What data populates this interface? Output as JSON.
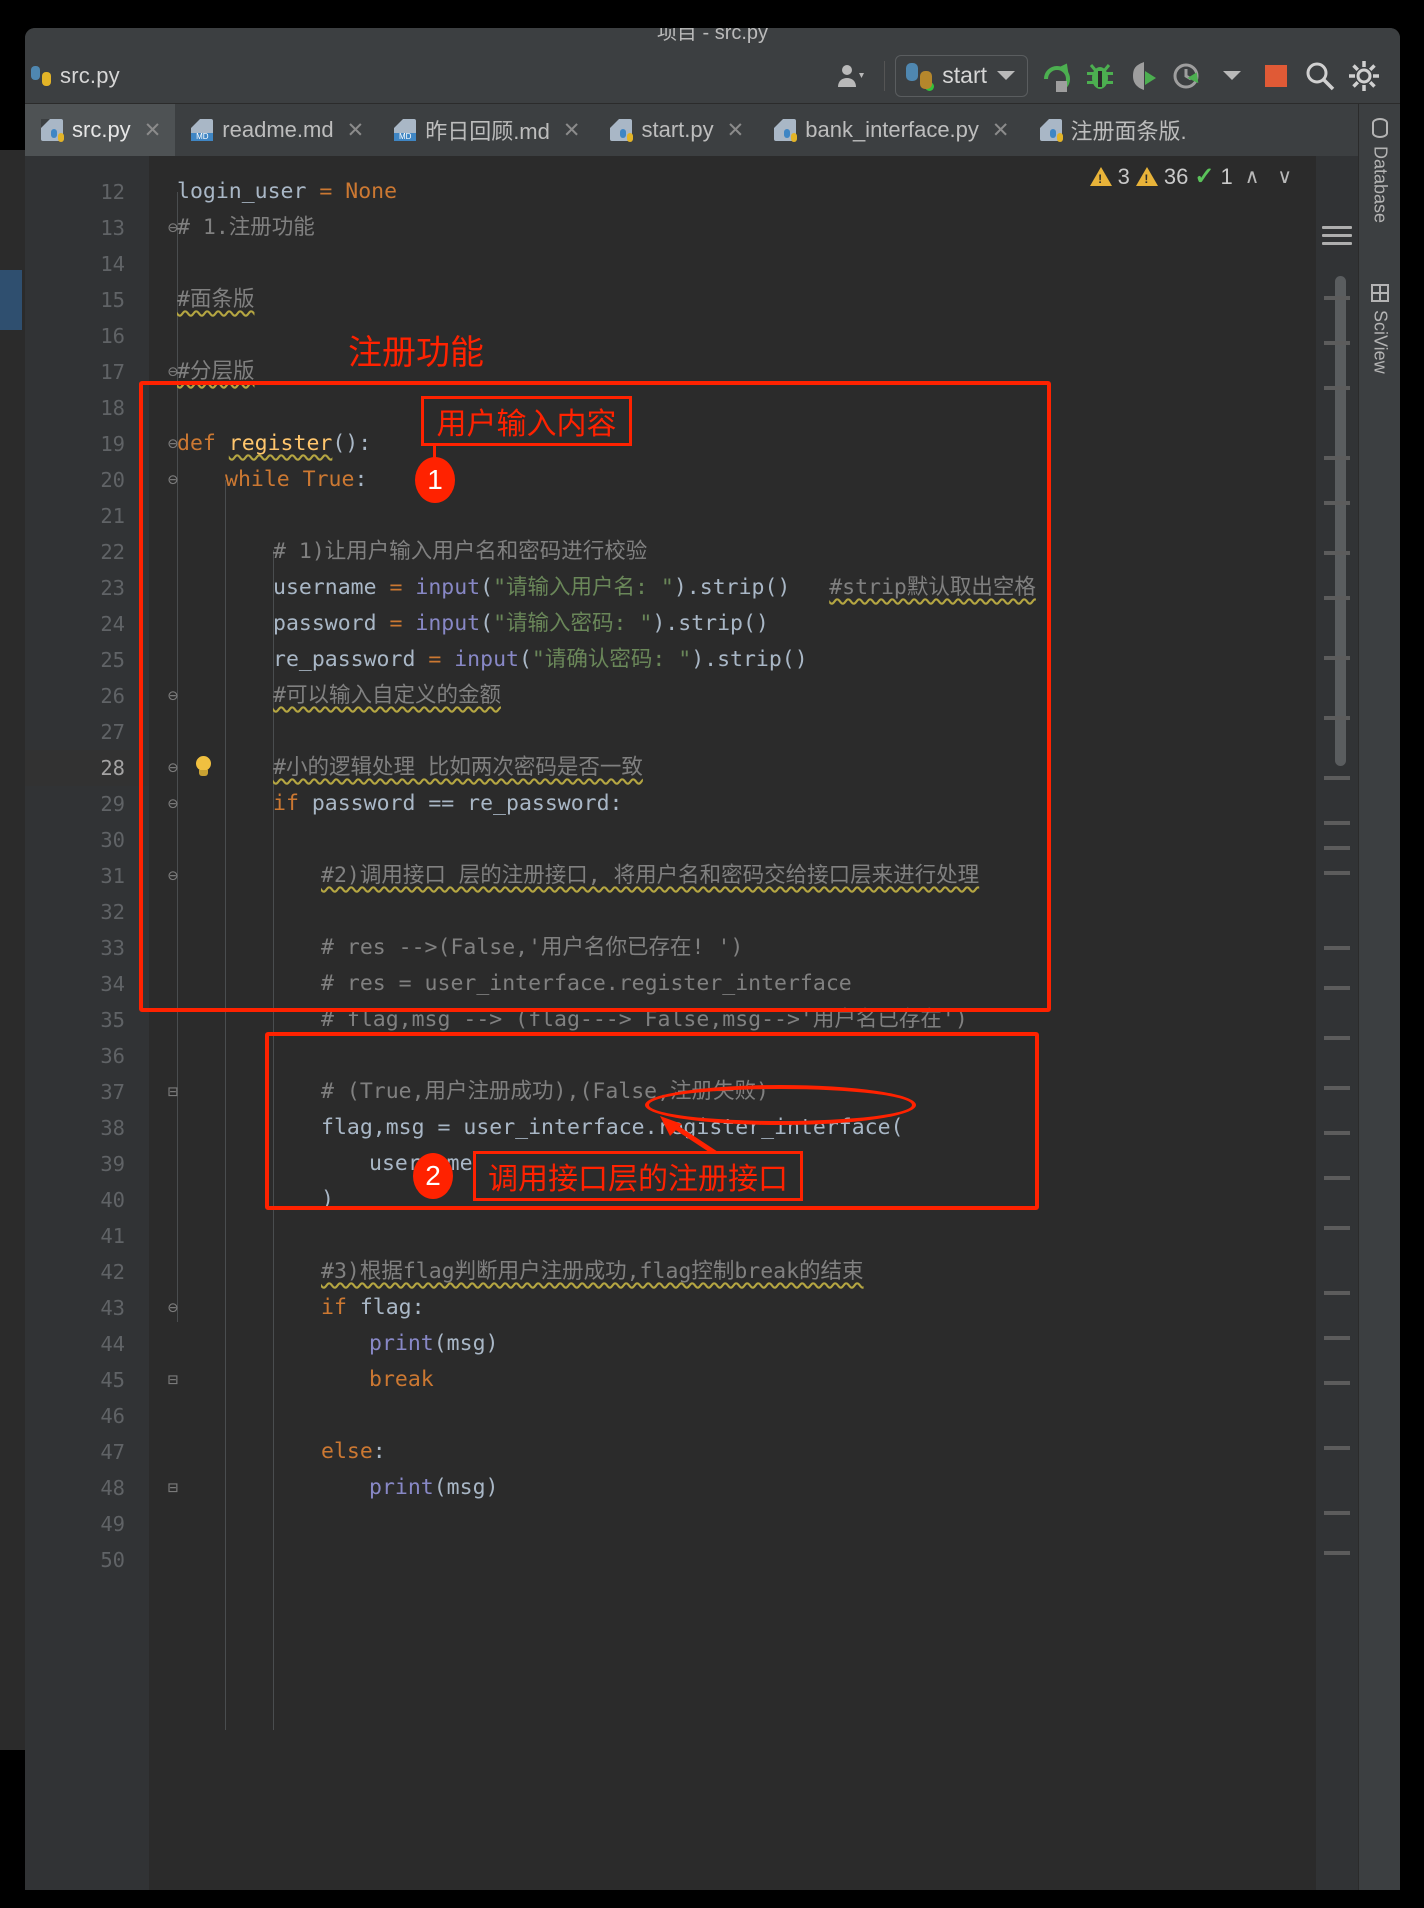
{
  "window": {
    "title_partial": "项目 - src.py",
    "breadcrumb": "src.py"
  },
  "toolbar": {
    "run_config_name": "start",
    "icons": [
      {
        "name": "user-avatar-icon",
        "glyph": "A"
      },
      {
        "name": "rerun-icon"
      },
      {
        "name": "debug-icon"
      },
      {
        "name": "coverage-icon"
      },
      {
        "name": "profile-icon"
      },
      {
        "name": "stop-icon"
      },
      {
        "name": "search-icon"
      },
      {
        "name": "settings-gear-icon"
      }
    ]
  },
  "tabs": [
    {
      "label": "src.py",
      "icon": "python-file-icon",
      "active": true
    },
    {
      "label": "readme.md",
      "icon": "markdown-file-icon",
      "active": false
    },
    {
      "label": "昨日回顾.md",
      "icon": "markdown-file-icon",
      "active": false
    },
    {
      "label": "start.py",
      "icon": "python-file-icon",
      "active": false
    },
    {
      "label": "bank_interface.py",
      "icon": "python-file-icon",
      "active": false
    },
    {
      "label": "注册面条版.",
      "icon": "python-file-icon",
      "active": false
    }
  ],
  "tab_overflow_label": "∨",
  "inspection": {
    "warning_count_1": "3",
    "warning_count_2": "36",
    "ok_count": "1",
    "prev_label": "∧",
    "next_label": "∨"
  },
  "right_sidebar": [
    {
      "label": "Database",
      "icon": "database-icon"
    },
    {
      "label": "SciView",
      "icon": "sciview-icon"
    }
  ],
  "editor": {
    "current_line": 28,
    "lines": [
      {
        "n": 12,
        "indent": 0,
        "tokens": [
          {
            "t": "login_user ",
            "c": "plain"
          },
          {
            "t": "= ",
            "c": "kw"
          },
          {
            "t": "None",
            "c": "kw"
          }
        ]
      },
      {
        "n": 13,
        "fold": "⊖",
        "indent": 0,
        "tokens": [
          {
            "t": "# 1.注册功能",
            "c": "cmt"
          }
        ]
      },
      {
        "n": 14,
        "indent": 0,
        "tokens": []
      },
      {
        "n": 15,
        "indent": 0,
        "tokens": [
          {
            "t": "#面条版",
            "c": "cmt wave"
          }
        ]
      },
      {
        "n": 16,
        "indent": 0,
        "tokens": []
      },
      {
        "n": 17,
        "fold": "⊖",
        "indent": 0,
        "tokens": [
          {
            "t": "#分层版",
            "c": "cmt wave"
          }
        ]
      },
      {
        "n": 18,
        "indent": 0,
        "tokens": []
      },
      {
        "n": 19,
        "fold": "⊖",
        "indent": 0,
        "tokens": [
          {
            "t": "def ",
            "c": "kw"
          },
          {
            "t": "register",
            "c": "fn wave"
          },
          {
            "t": "():",
            "c": "plain"
          }
        ]
      },
      {
        "n": 20,
        "fold": "⊖",
        "indent": 1,
        "tokens": [
          {
            "t": "while ",
            "c": "kw"
          },
          {
            "t": "True",
            "c": "kw"
          },
          {
            "t": ":",
            "c": "plain"
          }
        ]
      },
      {
        "n": 21,
        "indent": 0,
        "tokens": []
      },
      {
        "n": 22,
        "indent": 2,
        "tokens": [
          {
            "t": "# 1)让用户输入用户名和密码进行校验",
            "c": "cmt"
          }
        ]
      },
      {
        "n": 23,
        "indent": 2,
        "tokens": [
          {
            "t": "username ",
            "c": "plain"
          },
          {
            "t": "= ",
            "c": "kw"
          },
          {
            "t": "input",
            "c": "builtin"
          },
          {
            "t": "(",
            "c": "plain"
          },
          {
            "t": "\"请输入用户名: \"",
            "c": "str"
          },
          {
            "t": ").strip()",
            "c": "plain"
          },
          {
            "t": "   ",
            "c": "plain"
          },
          {
            "t": "#strip默认取出空格",
            "c": "cmt wave"
          }
        ]
      },
      {
        "n": 24,
        "indent": 2,
        "tokens": [
          {
            "t": "password ",
            "c": "plain"
          },
          {
            "t": "= ",
            "c": "kw"
          },
          {
            "t": "input",
            "c": "builtin"
          },
          {
            "t": "(",
            "c": "plain"
          },
          {
            "t": "\"请输入密码: \"",
            "c": "str"
          },
          {
            "t": ").strip()",
            "c": "plain"
          }
        ]
      },
      {
        "n": 25,
        "indent": 2,
        "tokens": [
          {
            "t": "re_password ",
            "c": "plain"
          },
          {
            "t": "= ",
            "c": "kw"
          },
          {
            "t": "input",
            "c": "builtin"
          },
          {
            "t": "(",
            "c": "plain"
          },
          {
            "t": "\"请确认密码: \"",
            "c": "str"
          },
          {
            "t": ").strip()",
            "c": "plain"
          }
        ]
      },
      {
        "n": 26,
        "fold": "⊖",
        "indent": 2,
        "tokens": [
          {
            "t": "#可以输入自定义的金额",
            "c": "cmt wave"
          }
        ]
      },
      {
        "n": 27,
        "indent": 0,
        "tokens": []
      },
      {
        "n": 28,
        "fold": "⊖",
        "indent": 2,
        "tokens": [
          {
            "t": "#小的逻辑处理 比如两次密码是否一致",
            "c": "cmt wave"
          }
        ]
      },
      {
        "n": 29,
        "fold": "⊖",
        "indent": 2,
        "tokens": [
          {
            "t": "if ",
            "c": "kw"
          },
          {
            "t": "password == re_password:",
            "c": "plain"
          }
        ]
      },
      {
        "n": 30,
        "indent": 0,
        "tokens": []
      },
      {
        "n": 31,
        "fold": "⊖",
        "indent": 3,
        "tokens": [
          {
            "t": "#2)调用接口 层的注册接口, 将用户名和密码交给接口层来进行处理",
            "c": "cmt wave"
          }
        ]
      },
      {
        "n": 32,
        "indent": 0,
        "tokens": []
      },
      {
        "n": 33,
        "indent": 3,
        "tokens": [
          {
            "t": "# res -->(False,'用户名你已存在! ')",
            "c": "cmt"
          }
        ]
      },
      {
        "n": 34,
        "indent": 3,
        "tokens": [
          {
            "t": "# res = user_interface.register_interface",
            "c": "cmt"
          }
        ]
      },
      {
        "n": 35,
        "indent": 3,
        "tokens": [
          {
            "t": "# flag,msg --> (flag---> False,msg-->'用户名已存在')",
            "c": "cmt"
          }
        ]
      },
      {
        "n": 36,
        "indent": 0,
        "tokens": []
      },
      {
        "n": 37,
        "fold": "⊟",
        "indent": 3,
        "tokens": [
          {
            "t": "# (True,用户注册成功),(False,注册失败)",
            "c": "cmt"
          }
        ]
      },
      {
        "n": 38,
        "indent": 3,
        "tokens": [
          {
            "t": "flag,msg = user_interface.register_interface(",
            "c": "plain"
          }
        ]
      },
      {
        "n": 39,
        "indent": 4,
        "tokens": [
          {
            "t": "username,password",
            "c": "plain"
          }
        ]
      },
      {
        "n": 40,
        "indent": 3,
        "tokens": [
          {
            "t": ")",
            "c": "plain"
          }
        ]
      },
      {
        "n": 41,
        "indent": 0,
        "tokens": []
      },
      {
        "n": 42,
        "indent": 3,
        "tokens": [
          {
            "t": "#3)根据flag判断用户注册成功,flag控制break的结束",
            "c": "cmt wave"
          }
        ]
      },
      {
        "n": 43,
        "fold": "⊖",
        "indent": 3,
        "tokens": [
          {
            "t": "if ",
            "c": "kw"
          },
          {
            "t": "flag:",
            "c": "plain"
          }
        ]
      },
      {
        "n": 44,
        "indent": 4,
        "tokens": [
          {
            "t": "print",
            "c": "builtin"
          },
          {
            "t": "(msg)",
            "c": "plain"
          }
        ]
      },
      {
        "n": 45,
        "fold": "⊟",
        "indent": 4,
        "tokens": [
          {
            "t": "break",
            "c": "kw"
          }
        ]
      },
      {
        "n": 46,
        "indent": 0,
        "tokens": []
      },
      {
        "n": 47,
        "indent": 3,
        "tokens": [
          {
            "t": "else",
            "c": "kw"
          },
          {
            "t": ":",
            "c": "plain"
          }
        ]
      },
      {
        "n": 48,
        "fold": "⊟",
        "indent": 4,
        "tokens": [
          {
            "t": "print",
            "c": "builtin"
          },
          {
            "t": "(msg)",
            "c": "plain"
          }
        ]
      },
      {
        "n": 49,
        "indent": 0,
        "tokens": []
      },
      {
        "n": 50,
        "indent": 0,
        "tokens": []
      }
    ]
  },
  "annotations": {
    "title_text": "注册功能",
    "label_1_text": "用户输入内容",
    "badge_1": "1",
    "label_2_text": "调用接口层的注册接口",
    "badge_2": "2",
    "highlight_call": "register_interface(",
    "color": "#ff2200"
  }
}
